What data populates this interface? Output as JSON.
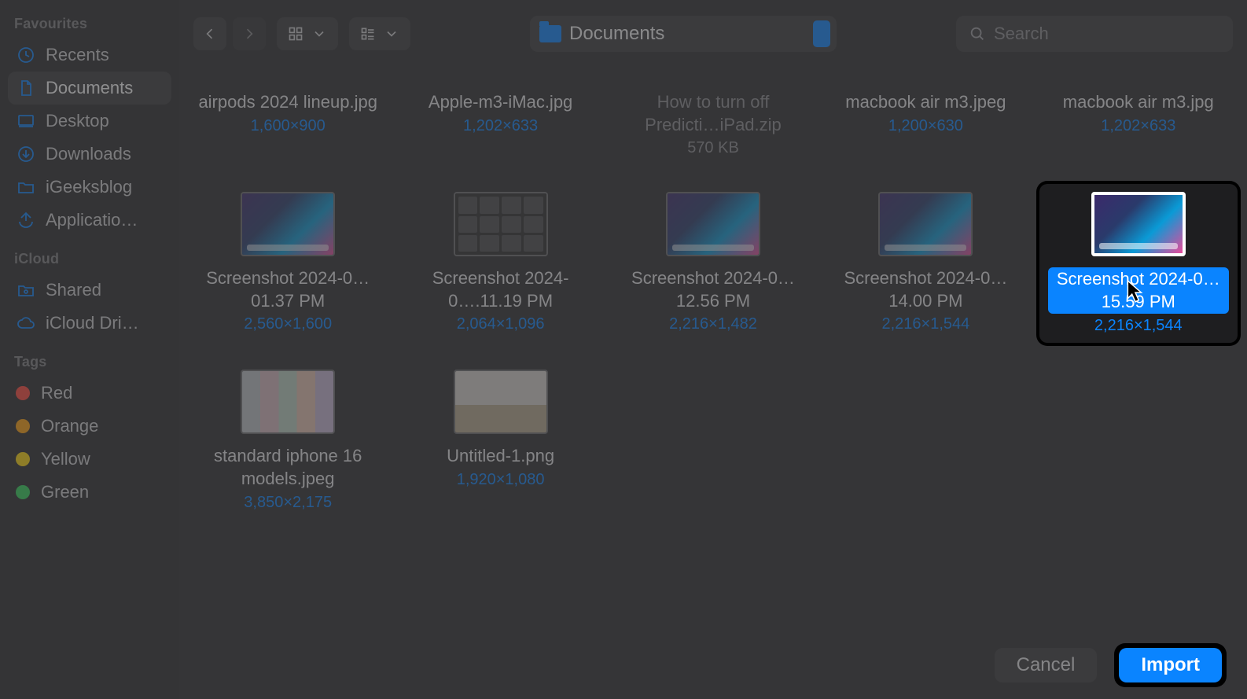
{
  "toolbar": {
    "location_label": "Documents",
    "search_placeholder": "Search"
  },
  "sidebar": {
    "sections": {
      "favourites": {
        "label": "Favourites",
        "items": [
          {
            "label": "Recents",
            "icon": "clock-icon"
          },
          {
            "label": "Documents",
            "icon": "document-icon",
            "selected": true
          },
          {
            "label": "Desktop",
            "icon": "desktop-icon"
          },
          {
            "label": "Downloads",
            "icon": "download-icon"
          },
          {
            "label": "iGeeksblog",
            "icon": "folder-icon"
          },
          {
            "label": "Applicatio…",
            "icon": "app-icon"
          }
        ]
      },
      "icloud": {
        "label": "iCloud",
        "items": [
          {
            "label": "Shared",
            "icon": "shared-folder-icon"
          },
          {
            "label": "iCloud Dri…",
            "icon": "cloud-icon"
          }
        ]
      },
      "tags": {
        "label": "Tags",
        "items": [
          {
            "label": "Red",
            "color": "#ff453a"
          },
          {
            "label": "Orange",
            "color": "#ff9f0a"
          },
          {
            "label": "Yellow",
            "color": "#ffd60a"
          },
          {
            "label": "Green",
            "color": "#30d158"
          }
        ]
      }
    }
  },
  "files": [
    {
      "name": "airpods 2024 lineup.jpg",
      "meta": "1,600×900",
      "thumb": null
    },
    {
      "name": "Apple-m3-iMac.jpg",
      "meta": "1,202×633",
      "thumb": null
    },
    {
      "name": "How to turn off Predicti…iPad.zip",
      "meta": "570 KB",
      "thumb": null,
      "disabled": true
    },
    {
      "name": "macbook air m3.jpeg",
      "meta": "1,200×630",
      "thumb": null
    },
    {
      "name": "macbook air m3.jpg",
      "meta": "1,202×633",
      "thumb": null
    },
    {
      "name": "Screenshot 2024-0…01.37 PM",
      "meta": "2,560×1,600",
      "thumb": "grad"
    },
    {
      "name": "Screenshot 2024-0….11.19 PM",
      "meta": "2,064×1,096",
      "thumb": "grid"
    },
    {
      "name": "Screenshot 2024-0…12.56 PM",
      "meta": "2,216×1,482",
      "thumb": "grad"
    },
    {
      "name": "Screenshot 2024-0…14.00 PM",
      "meta": "2,216×1,544",
      "thumb": "grad"
    },
    {
      "name": "Screenshot 2024-0…15.59 PM",
      "meta": "2,216×1,544",
      "thumb": "grad",
      "selected": true
    },
    {
      "name": "standard iphone 16 models.jpeg",
      "meta": "3,850×2,175",
      "thumb": "phones"
    },
    {
      "name": "Untitled-1.png",
      "meta": "1,920×1,080",
      "thumb": "store"
    }
  ],
  "footer": {
    "cancel_label": "Cancel",
    "import_label": "Import"
  }
}
